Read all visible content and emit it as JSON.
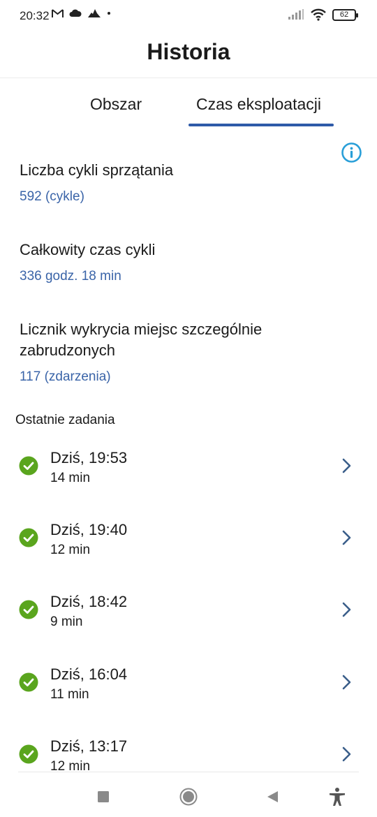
{
  "status_bar": {
    "time": "20:32",
    "battery": "62"
  },
  "header": {
    "title": "Historia"
  },
  "tabs": [
    {
      "label": "Obszar",
      "active": false
    },
    {
      "label": "Czas eksploatacji",
      "active": true
    }
  ],
  "stats": [
    {
      "label": "Liczba cykli sprzątania",
      "value": "592 (cykle)"
    },
    {
      "label": "Całkowity czas cykli",
      "value": "336 godz. 18 min"
    },
    {
      "label": "Licznik wykrycia miejsc szczególnie zabrudzonych",
      "value": "117 (zdarzenia)"
    }
  ],
  "recent": {
    "title": "Ostatnie zadania",
    "tasks": [
      {
        "time": "Dziś, 19:53",
        "duration": "14 min"
      },
      {
        "time": "Dziś, 19:40",
        "duration": "12 min"
      },
      {
        "time": "Dziś, 18:42",
        "duration": "9 min"
      },
      {
        "time": "Dziś, 16:04",
        "duration": "11 min"
      },
      {
        "time": "Dziś, 13:17",
        "duration": "12 min"
      }
    ]
  },
  "colors": {
    "accent": "#2e5aa8",
    "value_text": "#3a64a8",
    "success": "#5aa51e",
    "info": "#2a9fd8"
  }
}
